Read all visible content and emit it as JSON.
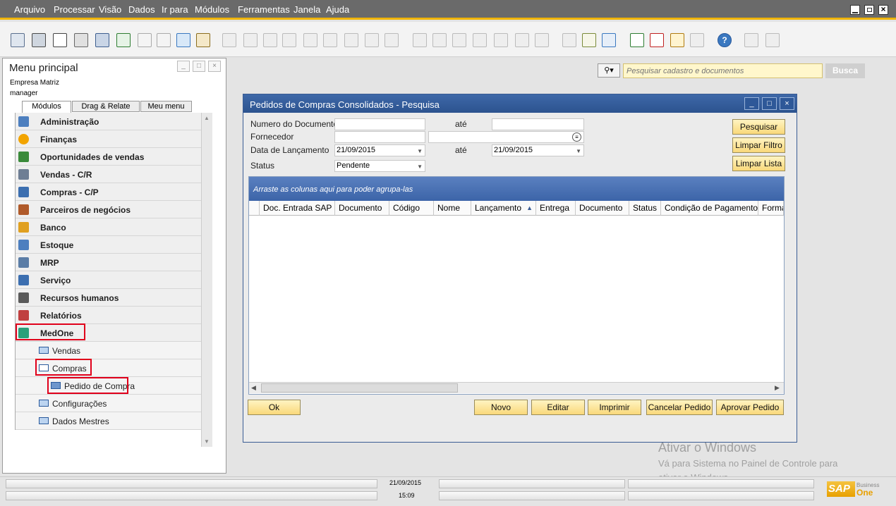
{
  "menubar": {
    "items": [
      "Arquivo",
      "Processar",
      "Visão",
      "Dados",
      "Ir para",
      "Módulos",
      "Ferramentas",
      "Janela",
      "Ajuda"
    ]
  },
  "menu_panel": {
    "title": "Menu principal",
    "company": "Empresa Matriz",
    "user": "manager",
    "tabs": [
      "Módulos",
      "Drag & Relate",
      "Meu menu"
    ],
    "modules": [
      {
        "label": "Administração",
        "icon": "admin-icon",
        "color": "#4d7fbf"
      },
      {
        "label": "Finanças",
        "icon": "finance-pie-icon",
        "color": "#f2a400"
      },
      {
        "label": "Oportunidades de vendas",
        "icon": "opportunities-icon",
        "color": "#3a8a3a"
      },
      {
        "label": "Vendas - C/R",
        "icon": "sales-tag-icon",
        "color": "#6e7e94"
      },
      {
        "label": "Compras - C/P",
        "icon": "cart-icon",
        "color": "#3c6fb0"
      },
      {
        "label": "Parceiros de negócios",
        "icon": "partners-icon",
        "color": "#b05a2a"
      },
      {
        "label": "Banco",
        "icon": "bank-icon",
        "color": "#e0a020"
      },
      {
        "label": "Estoque",
        "icon": "inventory-icon",
        "color": "#4d7fbf"
      },
      {
        "label": "MRP",
        "icon": "mrp-icon",
        "color": "#5b7da6"
      },
      {
        "label": "Serviço",
        "icon": "service-wrench-icon",
        "color": "#3c6fb0"
      },
      {
        "label": "Recursos humanos",
        "icon": "hr-icon",
        "color": "#5a5a5a"
      },
      {
        "label": "Relatórios",
        "icon": "reports-icon",
        "color": "#c04040"
      },
      {
        "label": "MedOne",
        "icon": "medone-box-icon",
        "color": "#2aa07a"
      }
    ],
    "submenu": {
      "vendas": "Vendas",
      "compras": "Compras",
      "pedido": "Pedido de Compra",
      "configuracoes": "Configurações",
      "dados_mestres": "Dados Mestres"
    }
  },
  "search": {
    "placeholder": "Pesquisar cadastro e documentos",
    "button": "Busca"
  },
  "form": {
    "title": "Pedidos de Compras Consolidados - Pesquisa",
    "labels": {
      "numero": "Numero do Documento",
      "ate1": "até",
      "fornecedor": "Fornecedor",
      "data": "Data de Lançamento",
      "ate2": "até",
      "status": "Status"
    },
    "values": {
      "numero_de": "",
      "numero_ate": "",
      "fornecedor_codigo": "",
      "fornecedor_nome": "",
      "data_de": "21/09/2015",
      "data_ate": "21/09/2015",
      "status": "Pendente"
    },
    "side_buttons": {
      "pesquisar": "Pesquisar",
      "limpar_filtro": "Limpar Filtro",
      "limpar_lista": "Limpar Lista"
    },
    "grid": {
      "group_hint": "Arraste as colunas aqui para poder agrupa-las",
      "columns": [
        "Doc. Entrada SAP",
        "Documento",
        "Código",
        "Nome",
        "Lançamento",
        "Entrega",
        "Documento",
        "Status",
        "Condição de Pagamento",
        "Forma"
      ],
      "sort_indicator": "▲"
    },
    "bottom_buttons": {
      "ok": "Ok",
      "novo": "Novo",
      "editar": "Editar",
      "imprimir": "Imprimir",
      "cancelar": "Cancelar Pedido",
      "aprovar": "Aprovar Pedido"
    }
  },
  "watermark": {
    "title": "Ativar o Windows",
    "line1": "Vá para Sistema no Painel de Controle para",
    "line2": "ativar o Windows."
  },
  "statusbar": {
    "date": "21/09/2015",
    "time": "15:09"
  },
  "brand": {
    "logo": "SAP",
    "business": "Business",
    "one": "One"
  }
}
